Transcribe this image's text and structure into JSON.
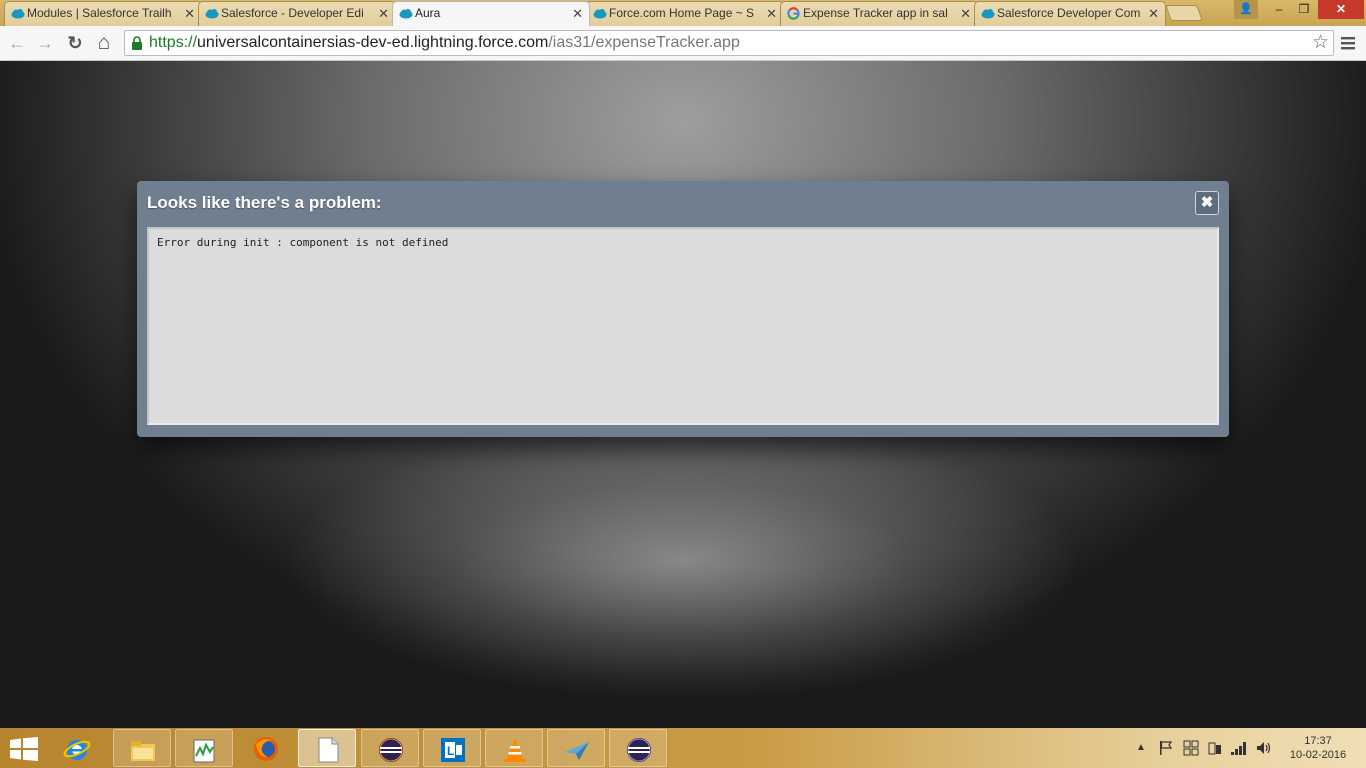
{
  "browser": {
    "tabs": [
      {
        "title": "Modules | Salesforce Trailh",
        "favicon": "salesforce-cloud-icon",
        "active": false
      },
      {
        "title": "Salesforce - Developer Edi",
        "favicon": "salesforce-cloud-icon",
        "active": false
      },
      {
        "title": "Aura",
        "favicon": "salesforce-cloud-icon",
        "active": true
      },
      {
        "title": "Force.com Home Page ~ S",
        "favicon": "salesforce-cloud-icon",
        "active": false
      },
      {
        "title": "Expense Tracker app in sal",
        "favicon": "google-g-icon",
        "active": false
      },
      {
        "title": "Salesforce Developer Com",
        "favicon": "salesforce-cloud-icon",
        "active": false
      }
    ],
    "tab_close_glyph": "✕",
    "window_controls": {
      "user": "👤",
      "minimize": "–",
      "restore": "❐",
      "close": "✕"
    },
    "toolbar": {
      "back": "←",
      "forward": "→",
      "reload": "↻",
      "home": "⌂"
    },
    "url": {
      "scheme": "https://",
      "host": "universalcontainersias-dev-ed.lightning.force.com",
      "path": "/ias31/expenseTracker.app"
    },
    "star": "☆"
  },
  "dialog": {
    "title": "Looks like there's a problem:",
    "close_glyph": "✖",
    "message": "Error during init : component is not defined"
  },
  "taskbar": {
    "apps": [
      {
        "name": "internet-explorer",
        "active": false
      },
      {
        "name": "file-explorer",
        "active": false
      },
      {
        "name": "task-manager",
        "active": false
      },
      {
        "name": "firefox",
        "active": false
      },
      {
        "name": "notepad",
        "active": true
      },
      {
        "name": "eclipse",
        "active": false
      },
      {
        "name": "lync",
        "active": false
      },
      {
        "name": "vlc",
        "active": false
      },
      {
        "name": "paper-plane",
        "active": false
      },
      {
        "name": "eclipse-2",
        "active": false
      }
    ],
    "time": "17:37",
    "date": "10-02-2016"
  },
  "colors": {
    "modal_header": "#6f7f8f",
    "modal_body": "#dcdcdc",
    "salesforce_blue": "#1798c1",
    "taskbar": "#c99b45"
  }
}
